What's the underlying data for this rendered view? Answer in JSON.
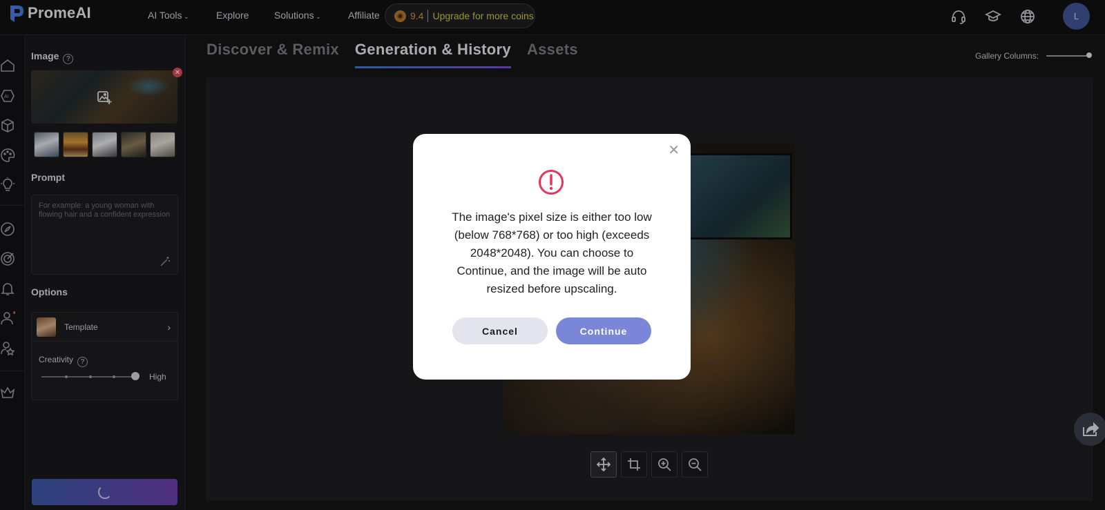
{
  "header": {
    "brand": "PromeAI",
    "nav": [
      {
        "label": "AI Tools",
        "dropdown": true
      },
      {
        "label": "Explore",
        "dropdown": false
      },
      {
        "label": "Solutions",
        "dropdown": true
      },
      {
        "label": "Affiliate",
        "dropdown": false
      }
    ],
    "coins": {
      "value": "9.4",
      "upgrade_label": "Upgrade for more coins"
    },
    "icons": [
      "headset-icon",
      "graduation-cap-icon",
      "globe-icon"
    ],
    "avatar_initial": "L"
  },
  "rail": {
    "icons": [
      "home-icon",
      "ai-icon",
      "cube-icon",
      "palette-icon",
      "lightbulb-icon",
      "compass-icon",
      "target-icon",
      "bell-icon",
      "user-icon",
      "user-star-icon",
      "crown-icon"
    ]
  },
  "panel": {
    "image_label": "Image",
    "prompt_label": "Prompt",
    "prompt_placeholder": "For example: a young woman with flowing hair and a confident expression",
    "options_label": "Options",
    "template_label": "Template",
    "creativity_label": "Creativity",
    "creativity_value": "High",
    "creativity_level": 1.0
  },
  "tabs": [
    {
      "label": "Discover & Remix",
      "active": false
    },
    {
      "label": "Generation & History",
      "active": true
    },
    {
      "label": "Assets",
      "active": false
    }
  ],
  "gallery": {
    "label": "Gallery Columns:"
  },
  "toolbar": {
    "tools": [
      "move-icon",
      "crop-icon",
      "zoom-in-icon",
      "zoom-out-icon"
    ]
  },
  "modal": {
    "message": "The image's pixel size is either too low (below 768*768) or too high (exceeds 2048*2048). You can choose to Continue, and the image will be auto resized before upscaling.",
    "cancel_label": "Cancel",
    "continue_label": "Continue"
  },
  "colors": {
    "accent": "#7a86d8",
    "warning": "#e8345c",
    "coin": "#c89a3c",
    "upgrade": "#c9c93c"
  }
}
